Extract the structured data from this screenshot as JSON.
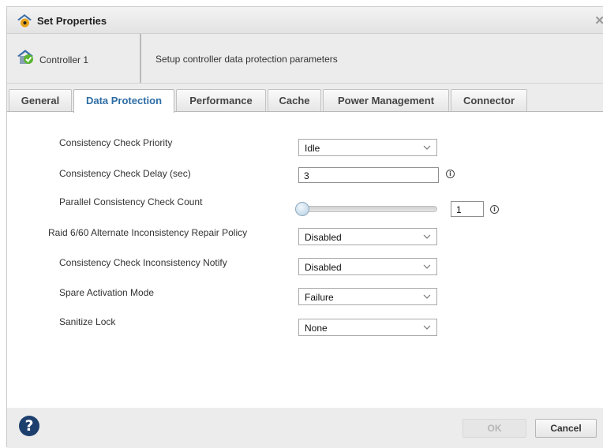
{
  "window": {
    "title": "Set Properties",
    "close_glyph": "✕"
  },
  "header": {
    "controller_name": "Controller 1",
    "description": "Setup controller data protection parameters"
  },
  "tabs": [
    {
      "label": "General",
      "active": false
    },
    {
      "label": "Data Protection",
      "active": true
    },
    {
      "label": "Performance",
      "active": false
    },
    {
      "label": "Cache",
      "active": false
    },
    {
      "label": "Power Management",
      "active": false
    },
    {
      "label": "Connector",
      "active": false
    }
  ],
  "form": {
    "consistency_check_priority": {
      "label": "Consistency Check Priority",
      "value": "Idle"
    },
    "consistency_check_delay": {
      "label": "Consistency Check Delay (sec)",
      "value": "3"
    },
    "parallel_consistency_check_count": {
      "label": "Parallel Consistency Check Count",
      "value": "1",
      "slider_fraction": 0.0
    },
    "raid_repair_policy": {
      "label": "Raid 6/60 Alternate Inconsistency Repair Policy",
      "value": "Disabled"
    },
    "inconsistency_notify": {
      "label": "Consistency Check Inconsistency Notify",
      "value": "Disabled"
    },
    "spare_activation_mode": {
      "label": "Spare Activation Mode",
      "value": "Failure"
    },
    "sanitize_lock": {
      "label": "Sanitize Lock",
      "value": "None"
    }
  },
  "footer": {
    "help_glyph": "?",
    "ok_label": "OK",
    "ok_enabled": false,
    "cancel_label": "Cancel"
  },
  "colors": {
    "active_tab_text": "#2e6da4",
    "help_icon_bg": "#1c3f6e",
    "check_green": "#5cb531",
    "roof_blue": "#3b6ea8"
  },
  "icons": {
    "title_icon": "settings-house-icon",
    "controller_icon": "controller-ok-icon",
    "info_icon": "info-icon",
    "dropdown_icon": "chevron-down-icon"
  }
}
